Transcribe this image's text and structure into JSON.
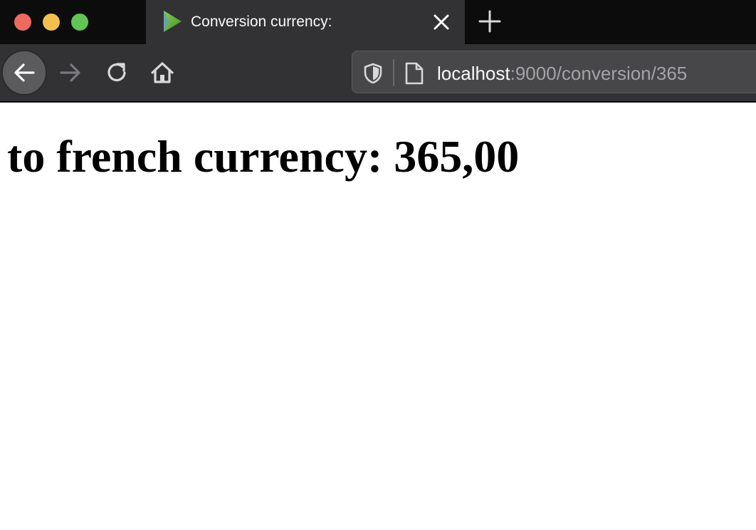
{
  "window": {
    "buttons": [
      "close",
      "minimize",
      "zoom"
    ],
    "colors": {
      "close": "#ed6a5e",
      "minimize": "#f5bf4f",
      "zoom": "#61c554"
    }
  },
  "tab": {
    "title": "Conversion currency:",
    "favicon": "play-logo-icon",
    "close_icon": "close-icon"
  },
  "new_tab": {
    "icon": "plus-icon"
  },
  "toolbar": {
    "back_icon": "arrow-left-icon",
    "forward_icon": "arrow-right-icon",
    "reload_icon": "reload-icon",
    "home_icon": "home-icon"
  },
  "urlbar": {
    "tracking_icon": "shield-icon",
    "page_icon": "page-icon",
    "host": "localhost",
    "path": ":9000/conversion/365"
  },
  "page": {
    "heading": "to french currency: 365,00"
  }
}
